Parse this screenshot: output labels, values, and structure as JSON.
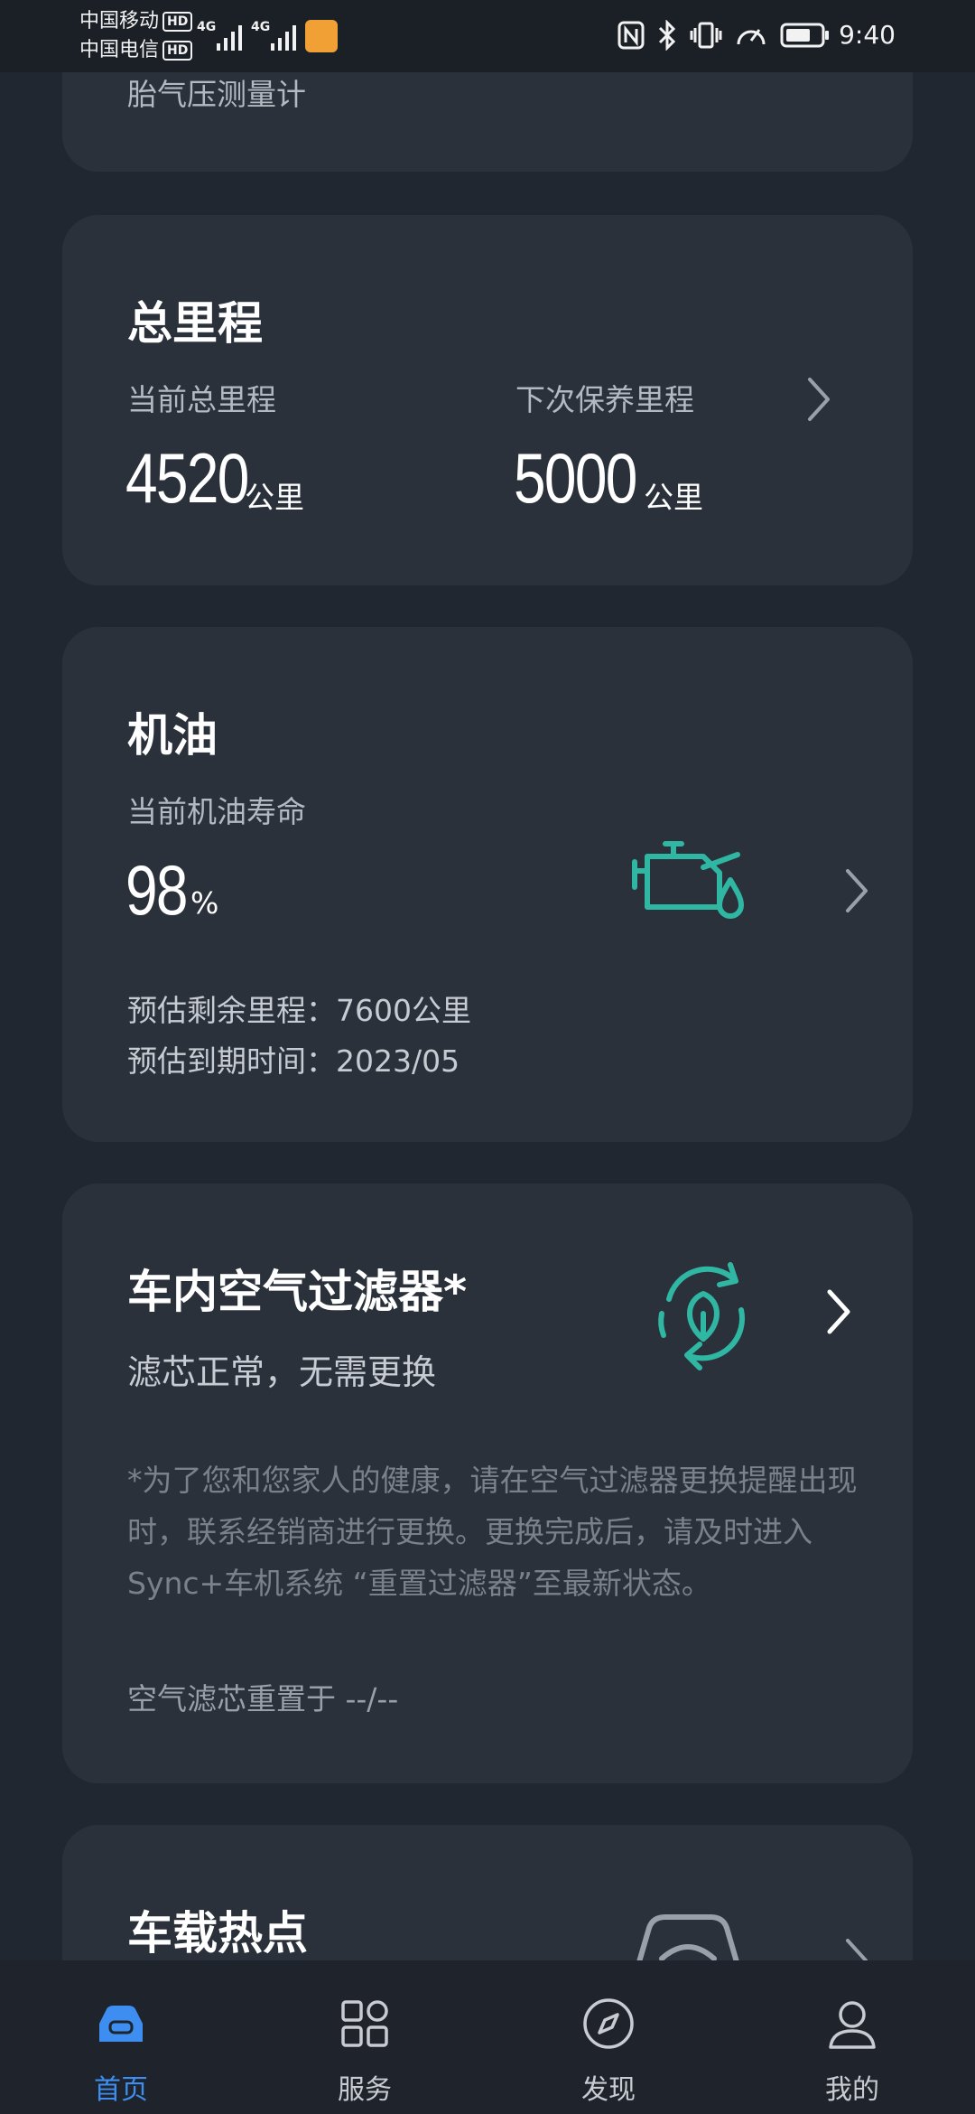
{
  "status_bar": {
    "carrier1": "中国移动",
    "carrier2": "中国电信",
    "hd": "HD",
    "signal_label": "4G",
    "time": "9:40",
    "icons": [
      "nfc-icon",
      "bluetooth-icon",
      "vibrate-icon",
      "speed-icon",
      "battery-icon"
    ]
  },
  "tire_card": {
    "partial_text": "胎气压测量计"
  },
  "mileage_card": {
    "title": "总里程",
    "current_label": "当前总里程",
    "current_value": "4520",
    "current_unit": "公里",
    "next_label": "下次保养里程",
    "next_value": "5000",
    "next_unit": "公里"
  },
  "oil_card": {
    "title": "机油",
    "life_label": "当前机油寿命",
    "life_value": "98",
    "life_unit": "%",
    "remaining_mileage": "预估剩余里程：7600公里",
    "due_date": "预估到期时间：2023/05"
  },
  "filter_card": {
    "title": "车内空气过滤器*",
    "status": "滤芯正常，无需更换",
    "note": "*为了您和您家人的健康，请在空气过滤器更换提醒出现时，联系经销商进行更换。更换完成后，请及时进入Sync+车机系统 “重置过滤器”至最新状态。",
    "reset_info": "空气滤芯重置于 --/--"
  },
  "hotspot_card": {
    "title": "车载热点"
  },
  "bottom_nav": {
    "items": [
      {
        "label": "首页",
        "icon": "car-icon",
        "active": true
      },
      {
        "label": "服务",
        "icon": "grid-icon",
        "active": false
      },
      {
        "label": "发现",
        "icon": "compass-icon",
        "active": false
      },
      {
        "label": "我的",
        "icon": "person-icon",
        "active": false
      }
    ]
  },
  "colors": {
    "background": "#212730",
    "card": "#2b313b",
    "accent_teal": "#2fb7a3",
    "nav_active": "#3d8ef0"
  }
}
